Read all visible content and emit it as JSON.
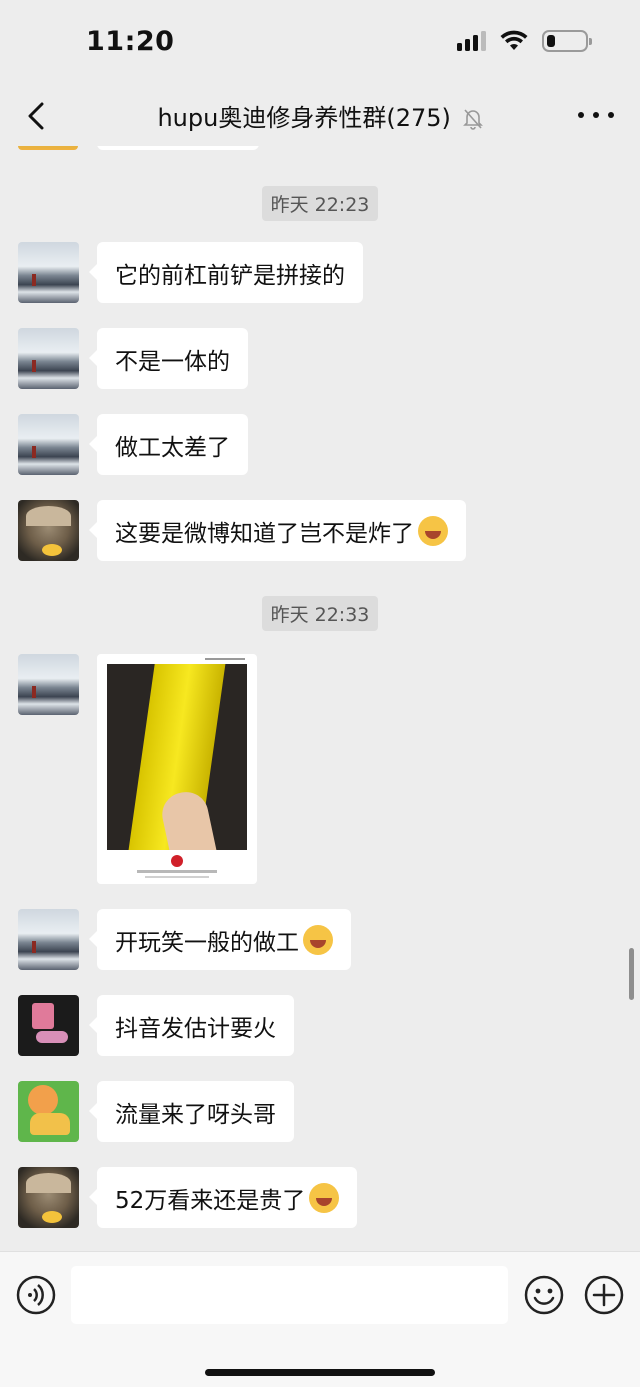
{
  "status_bar": {
    "time": "11:20"
  },
  "header": {
    "title": "hupu奥迪修身养性群(275)"
  },
  "timestamps": [
    "昨天 22:23",
    "昨天 22:33"
  ],
  "messages": [
    {
      "avatar": "mountain-avatar",
      "text": "它的前杠前铲是拼接的"
    },
    {
      "avatar": "mountain-avatar",
      "text": "不是一体的"
    },
    {
      "avatar": "mountain-avatar",
      "text": "做工太差了"
    },
    {
      "avatar": "cat-avatar",
      "text": "这要是微博知道了岂不是炸了",
      "emoji": "tears-of-joy-emoji"
    },
    {
      "avatar": "mountain-avatar",
      "type": "image",
      "image": "yellow-car-bumper-photo"
    },
    {
      "avatar": "mountain-avatar",
      "text": "开玩笑一般的做工",
      "emoji": "sweat-emoji"
    },
    {
      "avatar": "dark-avatar",
      "text": "抖音发估计要火"
    },
    {
      "avatar": "green-avatar",
      "text": "流量来了呀头哥"
    },
    {
      "avatar": "cat-avatar",
      "text": "52万看来还是贵了",
      "emoji": "tears-of-joy-emoji"
    }
  ],
  "input": {
    "placeholder": ""
  },
  "colors": {
    "bubble": "#ffffff",
    "background": "#ededed",
    "timestamp_bg": "#dcdcdc"
  }
}
